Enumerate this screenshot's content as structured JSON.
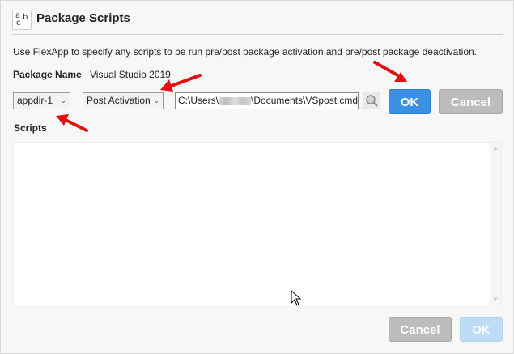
{
  "dialog": {
    "title": "Package Scripts",
    "icon": "abc-icon",
    "description": "Use FlexApp to specify any scripts to be run pre/post package activation and pre/post package deactivation."
  },
  "package": {
    "label": "Package Name",
    "value": "Visual Studio 2019"
  },
  "controls": {
    "scope_select": "appdir-1",
    "event_select": "Post Activation",
    "path_prefix": "C:\\Users\\",
    "path_suffix": "\\Documents\\VSpost.cmd",
    "ok_label": "OK",
    "cancel_label": "Cancel"
  },
  "scripts": {
    "label": "Scripts",
    "content": ""
  },
  "footer": {
    "cancel_label": "Cancel",
    "ok_label": "OK"
  },
  "colors": {
    "primary": "#3b8fe5",
    "secondary": "#bcbcbc",
    "annotation": "#e01010"
  }
}
